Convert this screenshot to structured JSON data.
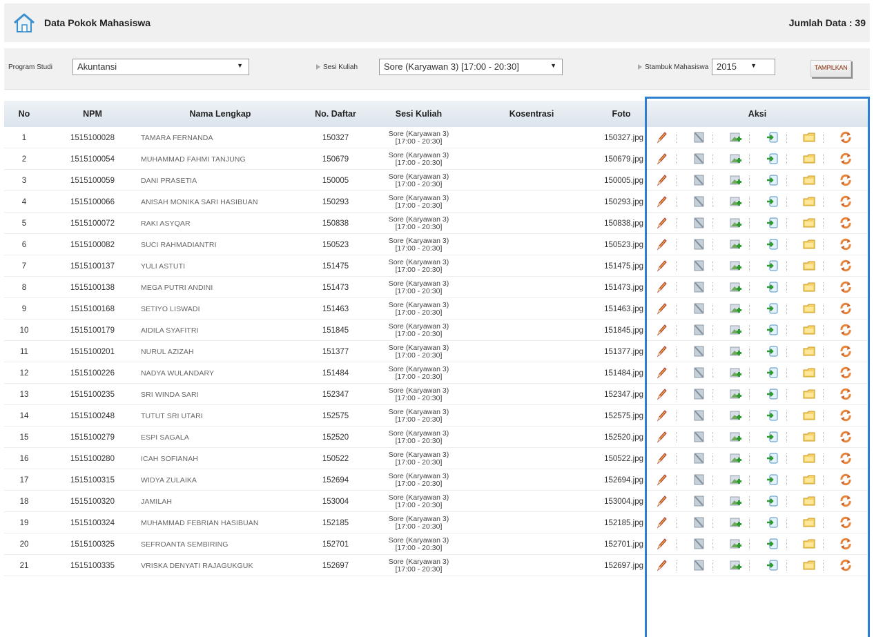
{
  "header": {
    "title": "Data Pokok Mahasiswa",
    "total": "Jumlah Data : 39"
  },
  "filters": {
    "program_label": "Program Studi",
    "program_value": "Akuntansi",
    "sesi_label": "Sesi Kuliah",
    "sesi_value": "Sore (Karyawan 3) [17:00 - 20:30]",
    "stambuk_label": "Stambuk Mahasiswa",
    "stambuk_value": "2015",
    "button": "TAMPILKAN"
  },
  "columns": {
    "no": "No",
    "npm": "NPM",
    "nama": "Nama Lengkap",
    "daftar": "No. Daftar",
    "sesi": "Sesi Kuliah",
    "kosentrasi": "Kosentrasi",
    "foto": "Foto",
    "aksi": "Aksi"
  },
  "colors": {
    "accent": "#2f7fd0",
    "button_text": "#8a2b0a"
  },
  "action_icons": [
    "edit-pencil-icon",
    "delete-icon",
    "image-add-icon",
    "import-icon",
    "folder-icon",
    "refresh-icon"
  ],
  "rows": [
    {
      "no": "1",
      "npm": "1515100028",
      "nama": "TAMARA FERNANDA",
      "daftar": "150327",
      "sesi1": "Sore (Karyawan 3)",
      "sesi2": "[17:00 - 20:30]",
      "kosentrasi": "",
      "foto": "150327.jpg"
    },
    {
      "no": "2",
      "npm": "1515100054",
      "nama": "MUHAMMAD FAHMI TANJUNG",
      "daftar": "150679",
      "sesi1": "Sore (Karyawan 3)",
      "sesi2": "[17:00 - 20:30]",
      "kosentrasi": "",
      "foto": "150679.jpg"
    },
    {
      "no": "3",
      "npm": "1515100059",
      "nama": "DANI PRASETIA",
      "daftar": "150005",
      "sesi1": "Sore (Karyawan 3)",
      "sesi2": "[17:00 - 20:30]",
      "kosentrasi": "",
      "foto": "150005.jpg"
    },
    {
      "no": "4",
      "npm": "1515100066",
      "nama": "ANISAH MONIKA SARI HASIBUAN",
      "daftar": "150293",
      "sesi1": "Sore (Karyawan 3)",
      "sesi2": "[17:00 - 20:30]",
      "kosentrasi": "",
      "foto": "150293.jpg"
    },
    {
      "no": "5",
      "npm": "1515100072",
      "nama": "RAKI ASYQAR",
      "daftar": "150838",
      "sesi1": "Sore (Karyawan 3)",
      "sesi2": "[17:00 - 20:30]",
      "kosentrasi": "",
      "foto": "150838.jpg"
    },
    {
      "no": "6",
      "npm": "1515100082",
      "nama": "SUCI RAHMADIANTRI",
      "daftar": "150523",
      "sesi1": "Sore (Karyawan 3)",
      "sesi2": "[17:00 - 20:30]",
      "kosentrasi": "",
      "foto": "150523.jpg"
    },
    {
      "no": "7",
      "npm": "1515100137",
      "nama": "YULI ASTUTI",
      "daftar": "151475",
      "sesi1": "Sore (Karyawan 3)",
      "sesi2": "[17:00 - 20:30]",
      "kosentrasi": "",
      "foto": "151475.jpg"
    },
    {
      "no": "8",
      "npm": "1515100138",
      "nama": "MEGA PUTRI ANDINI",
      "daftar": "151473",
      "sesi1": "Sore (Karyawan 3)",
      "sesi2": "[17:00 - 20:30]",
      "kosentrasi": "",
      "foto": "151473.jpg"
    },
    {
      "no": "9",
      "npm": "1515100168",
      "nama": "SETIYO LISWADI",
      "daftar": "151463",
      "sesi1": "Sore (Karyawan 3)",
      "sesi2": "[17:00 - 20:30]",
      "kosentrasi": "",
      "foto": "151463.jpg"
    },
    {
      "no": "10",
      "npm": "1515100179",
      "nama": "AIDILA SYAFITRI",
      "daftar": "151845",
      "sesi1": "Sore (Karyawan 3)",
      "sesi2": "[17:00 - 20:30]",
      "kosentrasi": "",
      "foto": "151845.jpg"
    },
    {
      "no": "11",
      "npm": "1515100201",
      "nama": "NURUL AZIZAH",
      "daftar": "151377",
      "sesi1": "Sore (Karyawan 3)",
      "sesi2": "[17:00 - 20:30]",
      "kosentrasi": "",
      "foto": "151377.jpg"
    },
    {
      "no": "12",
      "npm": "1515100226",
      "nama": "NADYA WULANDARY",
      "daftar": "151484",
      "sesi1": "Sore (Karyawan 3)",
      "sesi2": "[17:00 - 20:30]",
      "kosentrasi": "",
      "foto": "151484.jpg"
    },
    {
      "no": "13",
      "npm": "1515100235",
      "nama": "SRI WINDA SARI",
      "daftar": "152347",
      "sesi1": "Sore (Karyawan 3)",
      "sesi2": "[17:00 - 20:30]",
      "kosentrasi": "",
      "foto": "152347.jpg"
    },
    {
      "no": "14",
      "npm": "1515100248",
      "nama": "TUTUT SRI UTARI",
      "daftar": "152575",
      "sesi1": "Sore (Karyawan 3)",
      "sesi2": "[17:00 - 20:30]",
      "kosentrasi": "",
      "foto": "152575.jpg"
    },
    {
      "no": "15",
      "npm": "1515100279",
      "nama": "ESPI SAGALA",
      "daftar": "152520",
      "sesi1": "Sore (Karyawan 3)",
      "sesi2": "[17:00 - 20:30]",
      "kosentrasi": "",
      "foto": "152520.jpg"
    },
    {
      "no": "16",
      "npm": "1515100280",
      "nama": "ICAH SOFIANAH",
      "daftar": "150522",
      "sesi1": "Sore (Karyawan 3)",
      "sesi2": "[17:00 - 20:30]",
      "kosentrasi": "",
      "foto": "150522.jpg"
    },
    {
      "no": "17",
      "npm": "1515100315",
      "nama": "WIDYA ZULAIKA",
      "daftar": "152694",
      "sesi1": "Sore (Karyawan 3)",
      "sesi2": "[17:00 - 20:30]",
      "kosentrasi": "",
      "foto": "152694.jpg"
    },
    {
      "no": "18",
      "npm": "1515100320",
      "nama": "JAMILAH",
      "daftar": "153004",
      "sesi1": "Sore (Karyawan 3)",
      "sesi2": "[17:00 - 20:30]",
      "kosentrasi": "",
      "foto": "153004.jpg"
    },
    {
      "no": "19",
      "npm": "1515100324",
      "nama": "MUHAMMAD FEBRIAN HASIBUAN",
      "daftar": "152185",
      "sesi1": "Sore (Karyawan 3)",
      "sesi2": "[17:00 - 20:30]",
      "kosentrasi": "",
      "foto": "152185.jpg"
    },
    {
      "no": "20",
      "npm": "1515100325",
      "nama": "SEFROANTA SEMBIRING",
      "daftar": "152701",
      "sesi1": "Sore (Karyawan 3)",
      "sesi2": "[17:00 - 20:30]",
      "kosentrasi": "",
      "foto": "152701.jpg"
    },
    {
      "no": "21",
      "npm": "1515100335",
      "nama": "VRISKA DENYATI RAJAGUKGUK",
      "daftar": "152697",
      "sesi1": "Sore (Karyawan 3)",
      "sesi2": "[17:00 - 20:30]",
      "kosentrasi": "",
      "foto": "152697.jpg"
    }
  ]
}
